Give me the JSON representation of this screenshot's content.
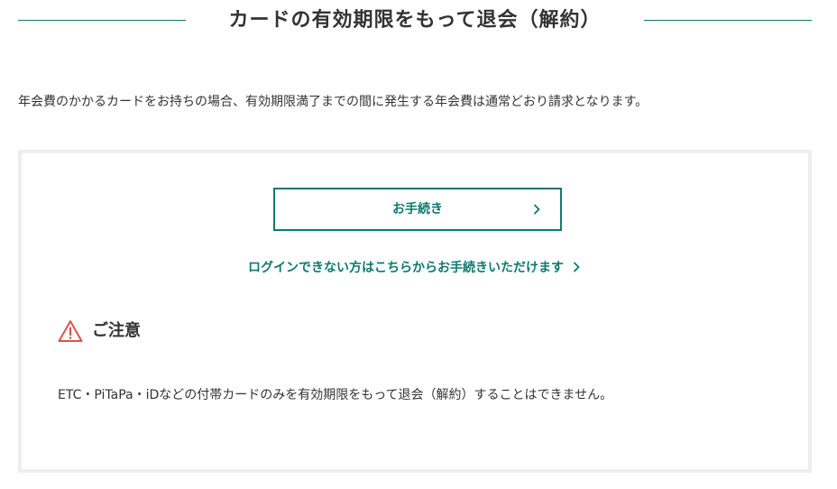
{
  "header": {
    "title": "カードの有効期限をもって退会（解約）"
  },
  "intro": {
    "text": "年会費のかかるカードをお持ちの場合、有効期限満了までの間に発生する年会費は通常どおり請求となります。"
  },
  "panel": {
    "procedure_button": {
      "label": "お手続き",
      "icon": "chevron-right-icon"
    },
    "login_link": {
      "label": "ログインできない方はこちらからお手続きいただけます",
      "icon": "chevron-right-icon"
    },
    "caution": {
      "icon": "warning-icon",
      "title": "ご注意",
      "text": "ETC・PiTaPa・iDなどの付帯カードのみを有効期限をもって退会（解約）することはできません。"
    }
  },
  "colors": {
    "accent": "#0d7a6d",
    "warning": "#d9534f",
    "panel_border": "#eeeeee",
    "text": "#333333"
  }
}
